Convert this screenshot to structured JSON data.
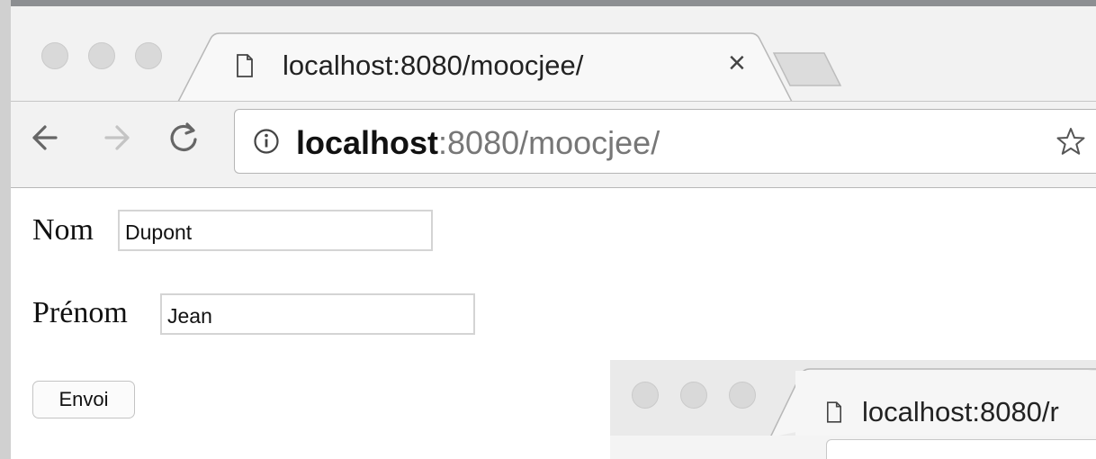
{
  "browser": {
    "tab_title": "localhost:8080/moocjee/",
    "close_symbol": "×",
    "address_host": "localhost",
    "address_rest": ":8080/moocjee/",
    "icons": [
      "back-arrow-icon",
      "forward-arrow-icon",
      "reload-icon",
      "info-icon",
      "bookmark-star-icon",
      "document-icon"
    ]
  },
  "form": {
    "nom_label": "Nom",
    "nom_value": "Dupont",
    "prenom_label": "Prénom",
    "prenom_value": "Jean",
    "submit_label": "Envoi"
  },
  "second_window": {
    "tab_title": "localhost:8080/r"
  }
}
